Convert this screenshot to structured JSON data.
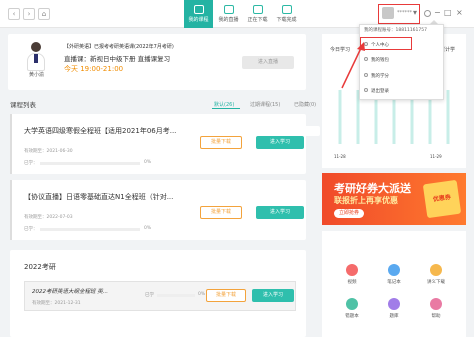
{
  "topbar": {
    "tabs": [
      {
        "label": "我的课程"
      },
      {
        "label": "我的直播"
      },
      {
        "label": "正在下载"
      },
      {
        "label": "下载完成"
      }
    ],
    "username": "******"
  },
  "course_top": {
    "title": "【外研英语】已报考考研英语课(2022年7月考研)",
    "subtitle": "直播课：新视日中级下册 直播课复习",
    "deadline": "今天 19:00-21:00",
    "teacher": "黄小渝",
    "go_label": "进入直播"
  },
  "list": {
    "title": "课程列表",
    "tabs": [
      {
        "label": "默认(26)"
      },
      {
        "label": "过期课程(15)"
      },
      {
        "label": "已隐藏(0)"
      }
    ]
  },
  "cards": [
    {
      "title": "大学英语四级寒假全程班【适用2021年06月考...",
      "meta": "有效期至：2021-06-30",
      "progress_label": "已学：",
      "percent": "0%",
      "btn1": "批量下载",
      "btn2": "进入学习"
    },
    {
      "title": "【协议直播】日语零基础直达N1全程班（针对...",
      "meta": "有效期至：2022-07-03",
      "progress_label": "已学：",
      "percent": "0%",
      "btn1": "批量下载",
      "btn2": "进入学习"
    }
  ],
  "group": {
    "title": "2022考研",
    "inner_title": "2022考研英语大纲全程班 英...",
    "inner_meta": "有效期至：2021-12-31",
    "progress_label": "已学",
    "percent": "0%",
    "btn1": "批量下载",
    "btn2": "进入学习"
  },
  "right_panel": {
    "label_left": "今日学习",
    "label_right": "累计学",
    "x_labels": [
      "11-28",
      "11-29"
    ],
    "progress": [
      0.1,
      0.25,
      0.55,
      0.4,
      0.7,
      0.65
    ]
  },
  "dropdown": {
    "header": "我的课程账号：18811161757",
    "items": [
      {
        "label": "个人中心"
      },
      {
        "label": "我的钱包"
      },
      {
        "label": "我的学分"
      },
      {
        "label": "退出登录"
      }
    ]
  },
  "banner": {
    "line1": "考研好券大派送",
    "line2": "联报折上再享优惠",
    "cta": "立即抢券",
    "badge": "优惠券"
  },
  "tools": [
    {
      "label": "视频",
      "color": "#f56b6b"
    },
    {
      "label": "笔记本",
      "color": "#5aa9f0"
    },
    {
      "label": "讲义下载",
      "color": "#f6b84d"
    },
    {
      "label": "错题本",
      "color": "#4fc2a6"
    },
    {
      "label": "题库",
      "color": "#a17de8"
    },
    {
      "label": "帮助",
      "color": "#e97aa3"
    }
  ]
}
